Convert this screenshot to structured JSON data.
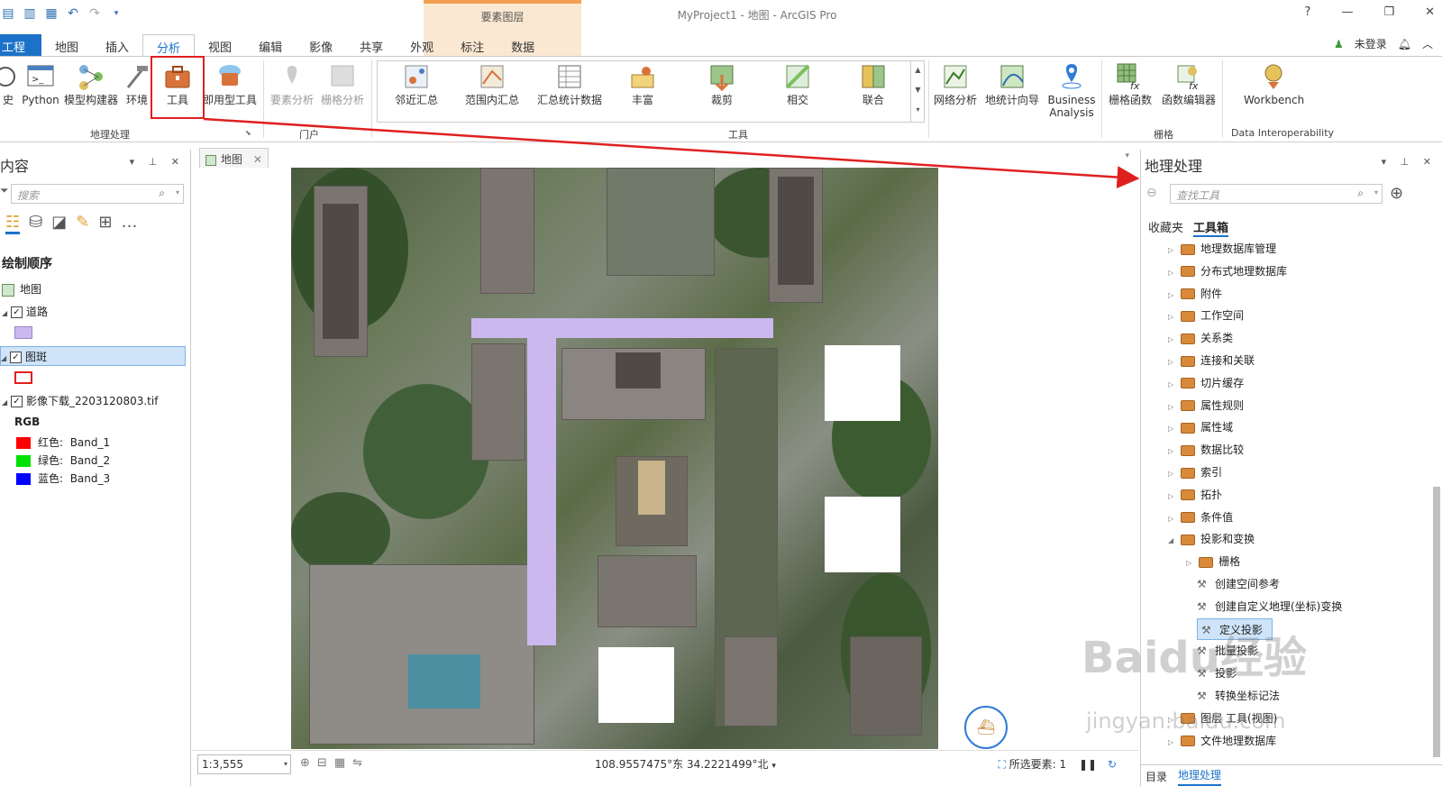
{
  "app": {
    "title": "MyProject1 - 地图 - ArcGIS Pro",
    "context_tab": "要素图层",
    "help": "?",
    "account": "未登录"
  },
  "ribbon_tabs": [
    "工程",
    "地图",
    "插入",
    "分析",
    "视图",
    "编辑",
    "影像",
    "共享",
    "外观",
    "标注",
    "数据"
  ],
  "active_tab": "分析",
  "ribbon": {
    "geoprocessing": {
      "group_label": "地理处理",
      "buttons": [
        "史",
        "Python",
        "模型构建器",
        "环境",
        "工具",
        "即用型工具"
      ]
    },
    "portal": {
      "group_label": "门户",
      "buttons": [
        "要素分析",
        "栅格分析"
      ]
    },
    "tools": {
      "group_label": "工具",
      "buttons": [
        "邻近汇总",
        "范围内汇总",
        "汇总统计数据",
        "丰富",
        "裁剪",
        "相交",
        "联合"
      ]
    },
    "network": {
      "buttons": [
        "网络分析",
        "地统计向导",
        "Business Analysis"
      ]
    },
    "raster": {
      "group_label": "栅格",
      "buttons": [
        "栅格函数",
        "函数编辑器"
      ]
    },
    "interop": {
      "group_label": "Data Interoperability",
      "buttons": [
        "Workbench"
      ]
    }
  },
  "contents": {
    "title": "内容",
    "search_placeholder": "搜索",
    "section": "绘制顺序",
    "map": "地图",
    "layers": [
      {
        "name": "道路",
        "checked": true
      },
      {
        "name": "图斑",
        "checked": true
      },
      {
        "name": "影像下载_2203120803.tif",
        "checked": true
      }
    ],
    "rgb_label": "RGB",
    "bands": [
      {
        "channel": "红色:",
        "band": "Band_1",
        "color": "#ff0000"
      },
      {
        "channel": "绿色:",
        "band": "Band_2",
        "color": "#00e000"
      },
      {
        "channel": "蓝色:",
        "band": "Band_3",
        "color": "#0000ff"
      }
    ]
  },
  "map": {
    "tab": "地图",
    "scale": "1:3,555",
    "coords": "108.9557475°东 34.2221499°北",
    "selected": "所选要素: 1"
  },
  "geoprocessing": {
    "title": "地理处理",
    "search_placeholder": "查找工具",
    "tabs": [
      "收藏夹",
      "工具箱"
    ],
    "toolboxes": [
      "地理数据库管理",
      "分布式地理数据库",
      "附件",
      "工作空间",
      "关系类",
      "连接和关联",
      "切片缓存",
      "属性规则",
      "属性域",
      "数据比较",
      "索引",
      "拓扑",
      "条件值",
      "投影和变换"
    ],
    "sub_toolbox": "栅格",
    "tools": [
      "创建空间参考",
      "创建自定义地理(坐标)变换",
      "定义投影",
      "批量投影",
      "投影",
      "转换坐标记法"
    ],
    "more": [
      "图层 工具(视图)",
      "文件地理数据库"
    ],
    "bottom_tabs": [
      "目录",
      "地理处理"
    ]
  },
  "watermark": {
    "line1": "Baidu经验",
    "line2": "jingyan.baidu.com"
  },
  "colors": {
    "accent": "#1c72c8",
    "road": "#cbb8ee",
    "highlight": "#e02020"
  }
}
